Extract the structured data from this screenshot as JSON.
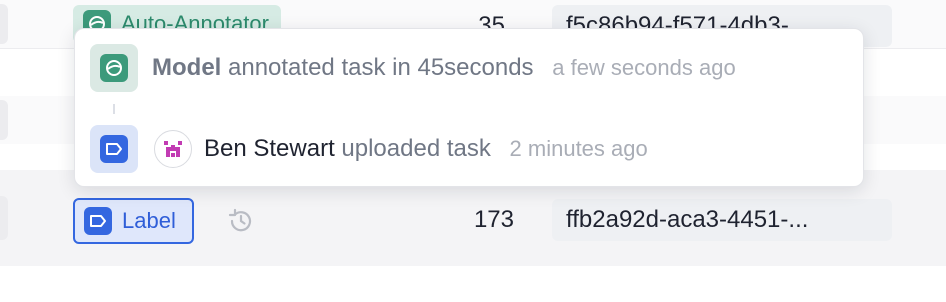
{
  "table": {
    "rows": [
      {
        "chip_label": "Auto-Annotator",
        "count": "35",
        "id": "f5c86b94-f571-4db3-..."
      },
      {
        "chip_label": "Label",
        "count": "173",
        "id": "ffb2a92d-aca3-4451-..."
      }
    ]
  },
  "history_popover": {
    "entries": [
      {
        "actor": "Model",
        "action": "annotated task in 45seconds",
        "time": "a few seconds ago",
        "icon": "model-icon"
      },
      {
        "actor": "Ben Stewart",
        "action": "uploaded task",
        "time": "2 minutes ago",
        "icon": "label-icon",
        "avatar": "avatar"
      }
    ]
  },
  "colors": {
    "auto_annotator_green": "#3c9a7b",
    "label_blue": "#3467e0",
    "avatar_magenta": "#c23bb3"
  }
}
